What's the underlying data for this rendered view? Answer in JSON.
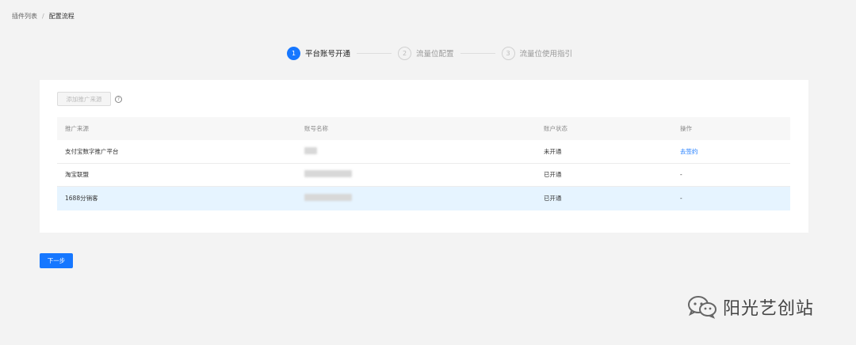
{
  "breadcrumb": {
    "items": [
      "插件列表",
      "/",
      "配置流程"
    ]
  },
  "steps": [
    {
      "num": "1",
      "label": "平台账号开通",
      "state": "active"
    },
    {
      "num": "2",
      "label": "流量位配置",
      "state": "inactive"
    },
    {
      "num": "3",
      "label": "流量位使用指引",
      "state": "inactive"
    }
  ],
  "toolbar": {
    "add_source_label": "添加推广来源",
    "help_glyph": "?"
  },
  "table": {
    "columns": [
      "推广来源",
      "账号名称",
      "账户状态",
      "操作"
    ],
    "rows": [
      {
        "source": "支付宝数字推广平台",
        "status": "未开通",
        "action": "去签约"
      },
      {
        "source": "淘宝联盟",
        "status": "已开通",
        "action": "-"
      },
      {
        "source": "1688分销客",
        "status": "已开通",
        "action": "-"
      }
    ]
  },
  "footer": {
    "next_label": "下一步"
  },
  "watermark": {
    "text": "阳光艺创站",
    "icon": "wechat-icon"
  },
  "colors": {
    "accent": "#1677ff",
    "highlight_row": "#e6f4ff",
    "page_bg": "#f3f3f3"
  }
}
